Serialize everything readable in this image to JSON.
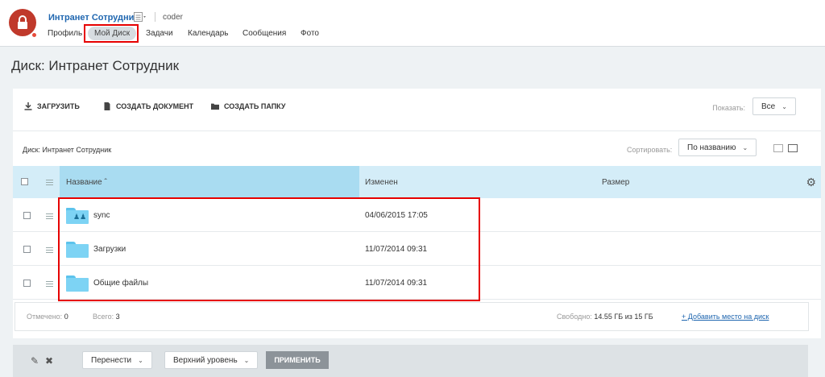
{
  "header": {
    "group_title": "Интранет Сотрудник",
    "user": "coder",
    "nav": [
      "Профиль",
      "Мой Диск",
      "Задачи",
      "Календарь",
      "Сообщения",
      "Фото"
    ],
    "active_nav": "Мой Диск"
  },
  "page": {
    "title": "Диск: Интранет Сотрудник"
  },
  "toolbar": {
    "upload": "ЗАГРУЗИТЬ",
    "create_doc": "СОЗДАТЬ ДОКУМЕНТ",
    "create_folder": "СОЗДАТЬ ПАПКУ",
    "show_label": "Показать:",
    "show_value": "Все"
  },
  "breadcrumb": "Диск: Интранет Сотрудник",
  "sort": {
    "label": "Сортировать:",
    "value": "По названию"
  },
  "table": {
    "columns": {
      "name": "Название",
      "modified": "Изменен",
      "size": "Размер"
    },
    "rows": [
      {
        "name": "sync",
        "modified": "04/06/2015 17:05",
        "shared": true
      },
      {
        "name": "Загрузки",
        "modified": "11/07/2014 09:31",
        "shared": false
      },
      {
        "name": "Общие файлы",
        "modified": "11/07/2014 09:31",
        "shared": false
      }
    ]
  },
  "summary": {
    "marked_label": "Отмечено:",
    "marked_value": "0",
    "total_label": "Всего:",
    "total_value": "3",
    "free_label": "Свободно:",
    "free_value": "14.55 ГБ из 15 ГБ",
    "add_space": "+ Добавить место на диск"
  },
  "actions": {
    "move": "Перенести",
    "level": "Верхний уровень",
    "apply": "ПРИМЕНИТЬ"
  },
  "colors": {
    "accent": "#2067b0",
    "header_bg": "#d4edf8",
    "highlight": "#e60000",
    "folder": "#7dd3f4"
  }
}
